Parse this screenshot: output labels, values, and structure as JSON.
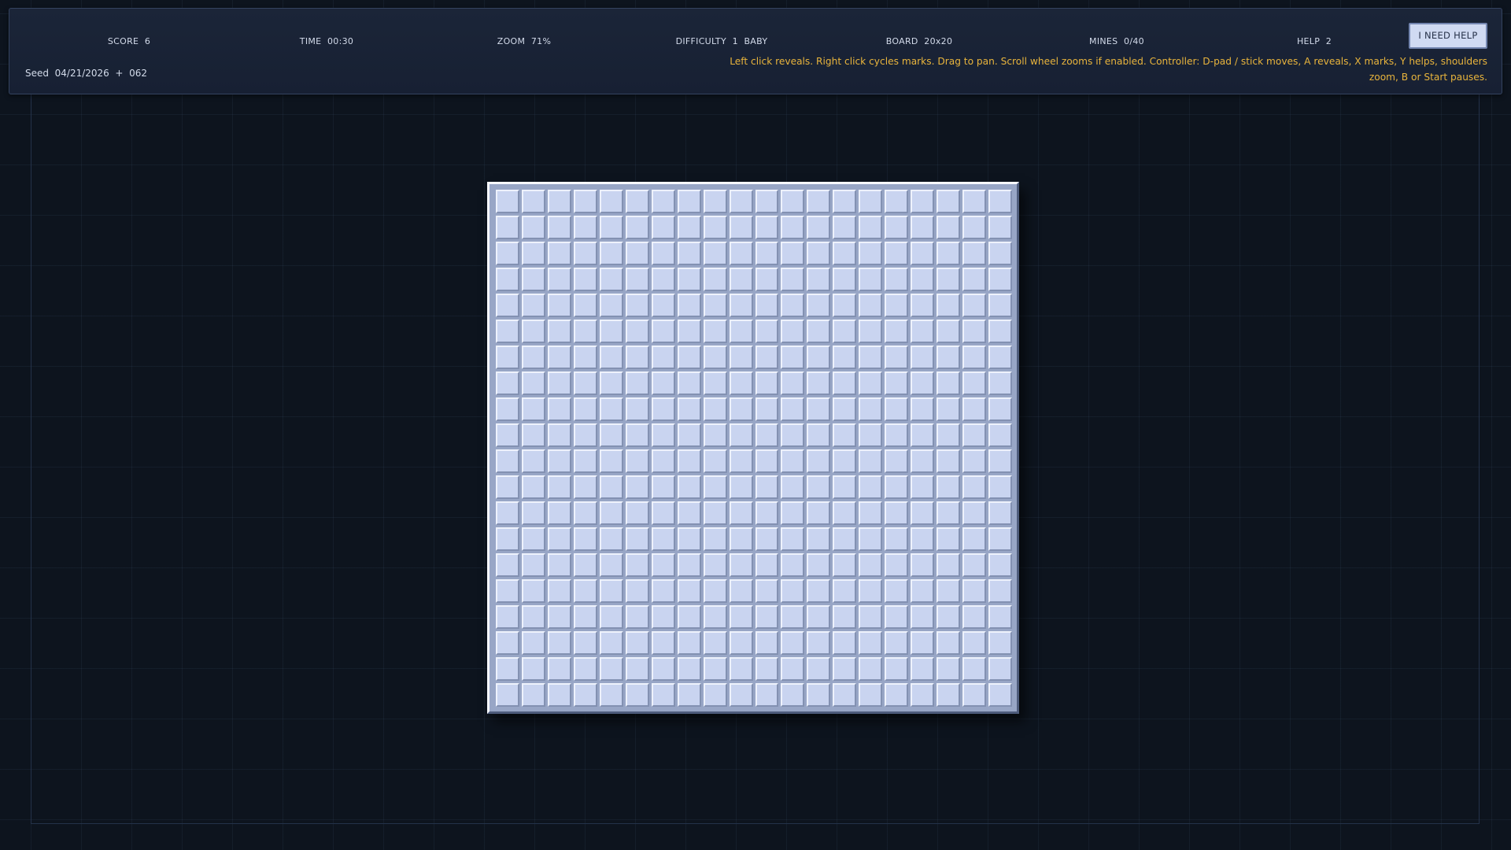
{
  "hud": {
    "score": "SCORE  6",
    "time": "TIME  00:30",
    "zoom": "ZOOM  71%",
    "difficulty": "DIFFICULTY  1  BABY",
    "board": "BOARD  20x20",
    "mines": "MINES  0/40",
    "help": "HELP  2",
    "help_button": "I NEED HELP",
    "seed": "Seed  04/21/2026  +  062",
    "hint": "Left click reveals. Right click cycles marks. Drag to pan. Scroll wheel zooms if enabled. Controller: D-pad / stick moves, A reveals, X marks, Y helps, shoulders zoom, B or Start pauses."
  },
  "board": {
    "rows": 20,
    "cols": 20,
    "state": "all cells unrevealed"
  },
  "colors": {
    "background": "#0d141e",
    "hud_panel": "#1b2538",
    "hint_text": "#e8b43c",
    "cell_face": "#c9d4f0",
    "button_face": "#d0daf2"
  }
}
